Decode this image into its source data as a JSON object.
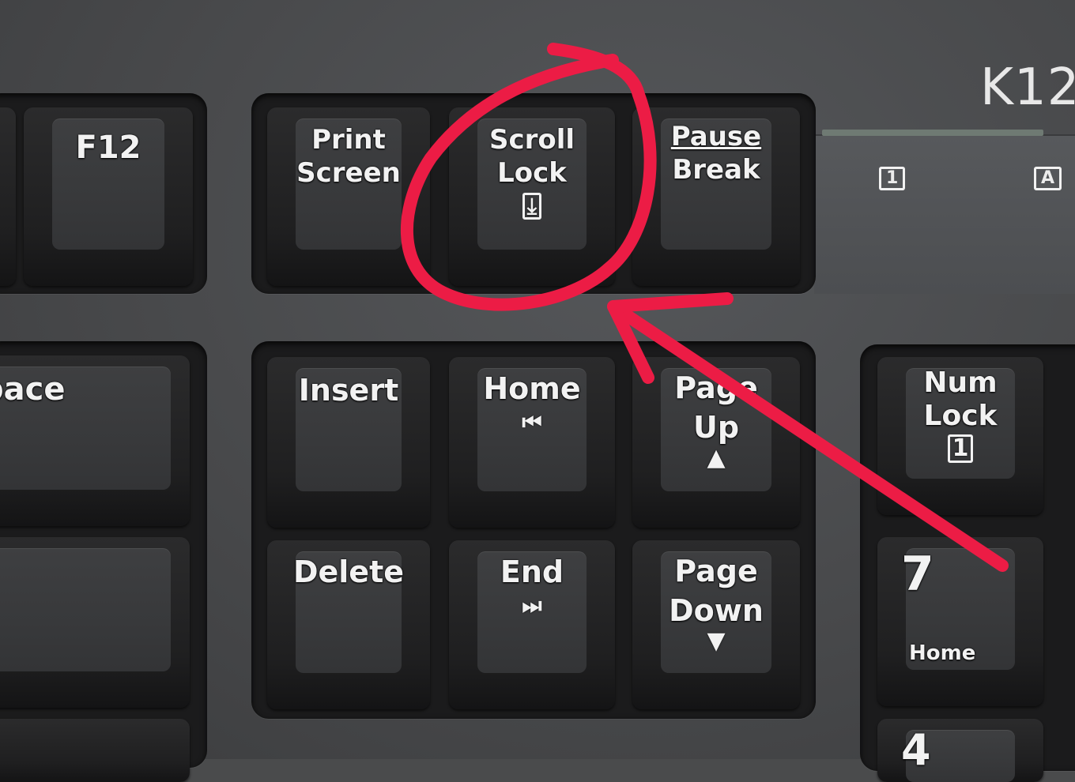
{
  "brand": {
    "text": "K12"
  },
  "indicators": {
    "num_lock_symbol": "1",
    "caps_lock_symbol": "A"
  },
  "keys": {
    "f12": {
      "label": "F12"
    },
    "print_screen": {
      "line1": "Print",
      "line2": "Screen"
    },
    "scroll_lock": {
      "line1": "Scroll",
      "line2": "Lock",
      "symbol": "⤓"
    },
    "pause_break": {
      "line1": "Pause",
      "line2": "Break"
    },
    "backspace": {
      "label": "pace"
    },
    "insert": {
      "label": "Insert"
    },
    "home": {
      "label": "Home",
      "symbol": "⏮"
    },
    "page_up": {
      "line1": "Page",
      "line2": "Up",
      "symbol": "▲"
    },
    "num_lock": {
      "line1": "Num",
      "line2": "Lock",
      "symbol": "1"
    },
    "delete": {
      "label": "Delete"
    },
    "end": {
      "label": "End",
      "symbol": "⏭"
    },
    "page_down": {
      "line1": "Page",
      "line2": "Down",
      "symbol": "▼"
    },
    "numpad_7": {
      "label": "7",
      "sublabel": "Home"
    },
    "numpad_4": {
      "label": "4"
    }
  },
  "annotation": {
    "color": "#ec1c45",
    "shape": "circle-and-arrow",
    "target": "Scroll Lock"
  }
}
